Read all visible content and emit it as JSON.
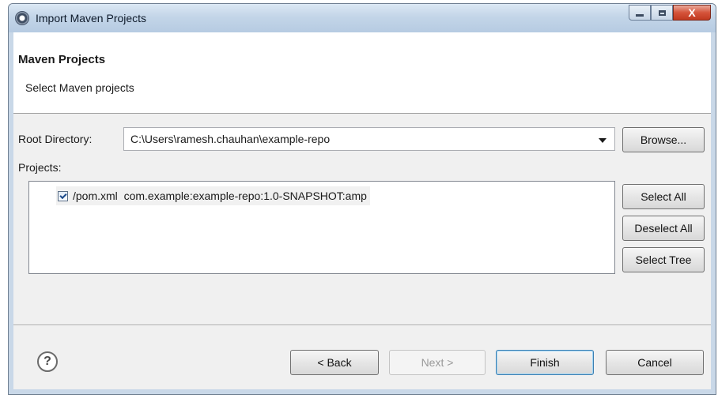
{
  "window": {
    "title": "Import Maven Projects",
    "controls": {
      "minimize_glyph": "",
      "maximize_glyph": "",
      "close_glyph": "X"
    }
  },
  "header": {
    "title": "Maven Projects",
    "subtitle": "Select Maven projects"
  },
  "root_directory": {
    "label": "Root Directory:",
    "value": "C:\\Users\\ramesh.chauhan\\example-repo",
    "browse_label": "Browse..."
  },
  "projects": {
    "label": "Projects:",
    "items": [
      {
        "checked": true,
        "text": "/pom.xml  com.example:example-repo:1.0-SNAPSHOT:amp"
      }
    ],
    "select_all_label": "Select All",
    "deselect_all_label": "Deselect All",
    "select_tree_label": "Select Tree"
  },
  "footer": {
    "help_glyph": "?",
    "back_label": "< Back",
    "next_label": "Next >",
    "finish_label": "Finish",
    "cancel_label": "Cancel"
  },
  "icons": {
    "app": "eclipse-icon",
    "help": "help-icon",
    "dropdown": "chevron-down-icon",
    "check": "checkmark-icon"
  }
}
